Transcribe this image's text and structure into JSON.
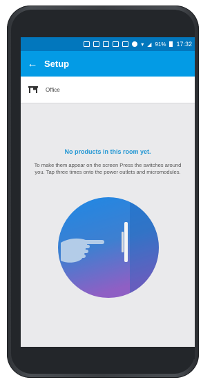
{
  "status_bar": {
    "battery_percent": "91%",
    "time": "17:32"
  },
  "app_bar": {
    "title": "Setup",
    "back_icon": "arrow-left-icon"
  },
  "room": {
    "icon": "desk-icon",
    "label": "Office"
  },
  "empty_state": {
    "title": "No products in this room yet.",
    "message": "To make them appear on the screen Press the switches around you. Tap three times onto the power outlets and micromodules."
  },
  "colors": {
    "status_bar": "#0277bd",
    "app_bar": "#039be5",
    "accent_text": "#2196d3",
    "illustration_top": "#1e88e5",
    "illustration_bottom": "#7e57c2"
  }
}
